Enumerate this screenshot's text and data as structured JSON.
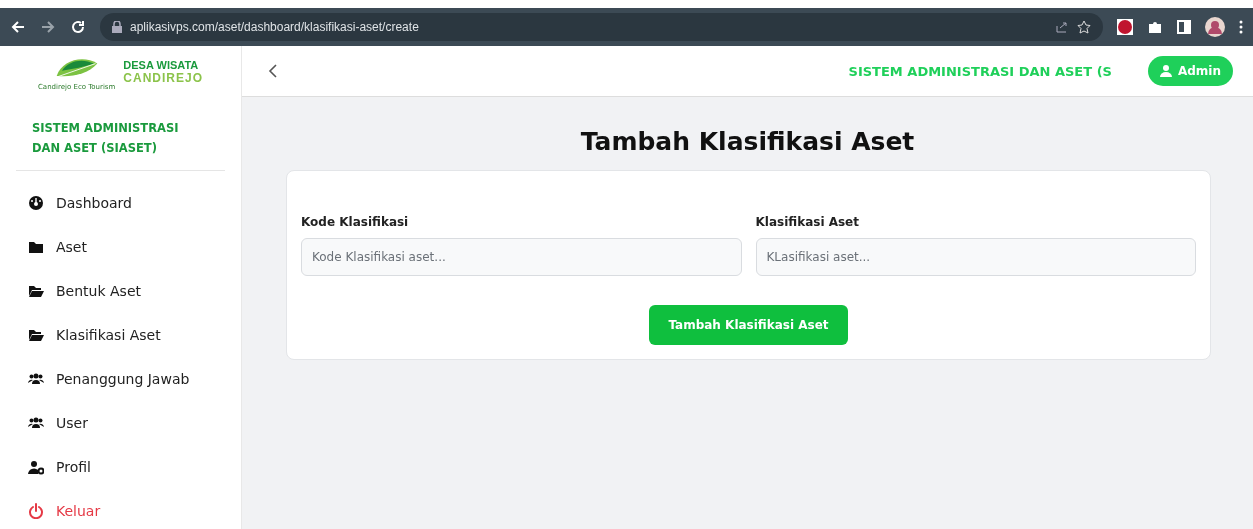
{
  "browser": {
    "url": "aplikasivps.com/aset/dashboard/klasifikasi-aset/create"
  },
  "sidebar": {
    "logo": {
      "line_1": "DESA WISATA",
      "line_2": "CANDIREJO",
      "tagline": "Candirejo Eco Tourism"
    },
    "app_title": "SISTEM ADMINISTRASI DAN ASET (SIASET)",
    "items": [
      {
        "label": "Dashboard",
        "kind": "dashboard"
      },
      {
        "label": "Aset",
        "kind": "folder"
      },
      {
        "label": "Bentuk Aset",
        "kind": "folder-open"
      },
      {
        "label": "Klasifikasi Aset",
        "kind": "folder-open"
      },
      {
        "label": "Penanggung Jawab",
        "kind": "users"
      },
      {
        "label": "User",
        "kind": "users"
      },
      {
        "label": "Profil",
        "kind": "user-cog"
      },
      {
        "label": "Keluar",
        "kind": "logout"
      }
    ]
  },
  "header": {
    "title": "SISTEM ADMINISTRASI DAN ASET (S",
    "user": "Admin"
  },
  "page": {
    "title": "Tambah Klasifikasi Aset",
    "fields": [
      {
        "label": "Kode Klasifikasi",
        "placeholder": "Kode Klasifikasi aset..."
      },
      {
        "label": "Klasifikasi Aset",
        "placeholder": "KLasifikasi aset..."
      }
    ],
    "submit": "Tambah Klasifikasi Aset"
  }
}
